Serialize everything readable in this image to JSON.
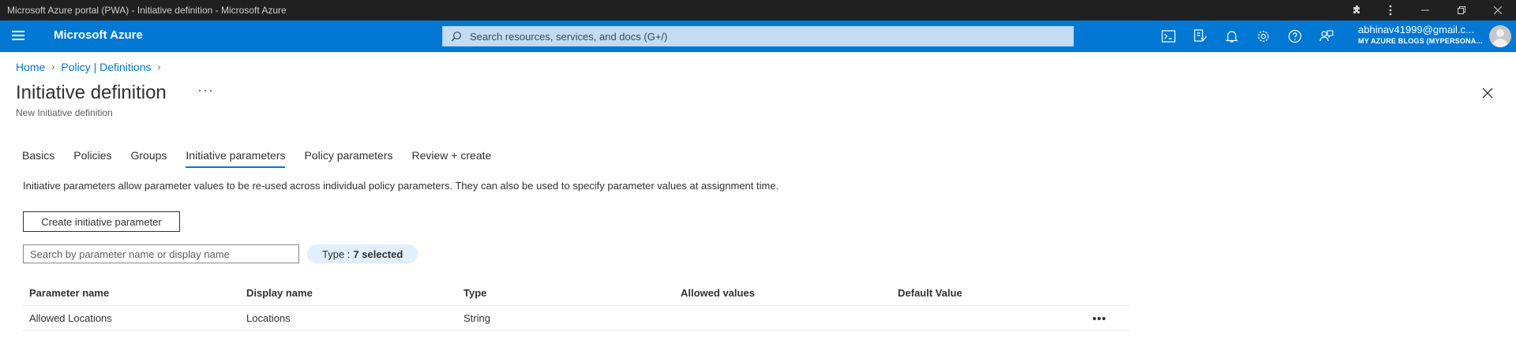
{
  "window": {
    "title": "Microsoft Azure portal (PWA) - Initiative definition - Microsoft Azure",
    "controls": [
      "extensions-icon",
      "more-icon",
      "minimize-icon",
      "restore-icon",
      "close-icon"
    ]
  },
  "header": {
    "brand": "Microsoft Azure",
    "search_placeholder": "Search resources, services, and docs (G+/)",
    "icons": [
      "cloud-shell-icon",
      "directory-filter-icon",
      "notifications-icon",
      "settings-icon",
      "help-icon",
      "feedback-icon"
    ],
    "account": {
      "name": "abhinav41999@gmail.c...",
      "directory": "MY AZURE BLOGS (MYPERSONA..."
    },
    "accent": "#0078d4"
  },
  "breadcrumb": [
    "Home",
    "Policy | Definitions"
  ],
  "page": {
    "title": "Initiative definition",
    "more": "···",
    "subtitle": "New Initiative definition"
  },
  "tabs": [
    {
      "label": "Basics",
      "active": false
    },
    {
      "label": "Policies",
      "active": false
    },
    {
      "label": "Groups",
      "active": false
    },
    {
      "label": "Initiative parameters",
      "active": true
    },
    {
      "label": "Policy parameters",
      "active": false
    },
    {
      "label": "Review + create",
      "active": false
    }
  ],
  "content": {
    "description": "Initiative parameters allow parameter values to be re-used across individual policy parameters. They can also be used to specify parameter values at assignment time.",
    "create_button": "Create initiative parameter",
    "filter_placeholder": "Search by parameter name or display name",
    "type_filter_label": "Type :",
    "type_filter_value": "7 selected"
  },
  "table": {
    "columns": [
      "Parameter name",
      "Display name",
      "Type",
      "Allowed values",
      "Default Value"
    ],
    "rows": [
      [
        "Allowed Locations",
        "Locations",
        "String",
        "",
        ""
      ]
    ]
  }
}
